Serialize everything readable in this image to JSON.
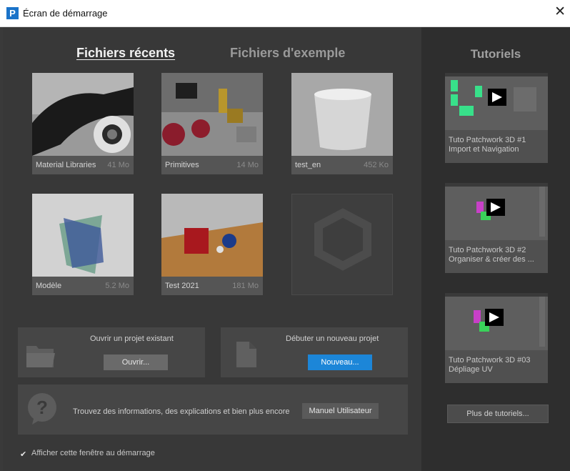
{
  "window": {
    "title": "Écran de démarrage",
    "app_icon_letter": "P"
  },
  "tabs": {
    "recent": "Fichiers récents",
    "examples": "Fichiers d'exemple"
  },
  "recent_files": [
    {
      "name": "Material Libraries",
      "size": "41 Mo"
    },
    {
      "name": "Primitives",
      "size": "14 Mo"
    },
    {
      "name": "test_en",
      "size": "452 Ko"
    },
    {
      "name": "Modèle",
      "size": "5.2 Mo"
    },
    {
      "name": "Test 2021",
      "size": "181 Mo"
    }
  ],
  "open_panel": {
    "title": "Ouvrir un projet existant",
    "button": "Ouvrir..."
  },
  "new_panel": {
    "title": "Débuter un nouveau projet",
    "button": "Nouveau..."
  },
  "help": {
    "text": "Trouvez des informations, des explications et bien plus encore",
    "button": "Manuel Utilisateur"
  },
  "startup_checkbox": {
    "label": "Afficher cette fenêtre au démarrage",
    "checked": true
  },
  "tutorials": {
    "title": "Tutoriels",
    "items": [
      {
        "line1": "Tuto Patchwork 3D #1",
        "line2": "Import et Navigation"
      },
      {
        "line1": "Tuto Patchwork 3D #2",
        "line2": "Organiser & créer des ..."
      },
      {
        "line1": "Tuto Patchwork 3D #03",
        "line2": "Dépliage UV"
      }
    ],
    "more_button": "Plus de tutoriels..."
  },
  "colors": {
    "accent": "#1c86d8",
    "background": "#383838",
    "sidebar": "#2e2e2e"
  }
}
